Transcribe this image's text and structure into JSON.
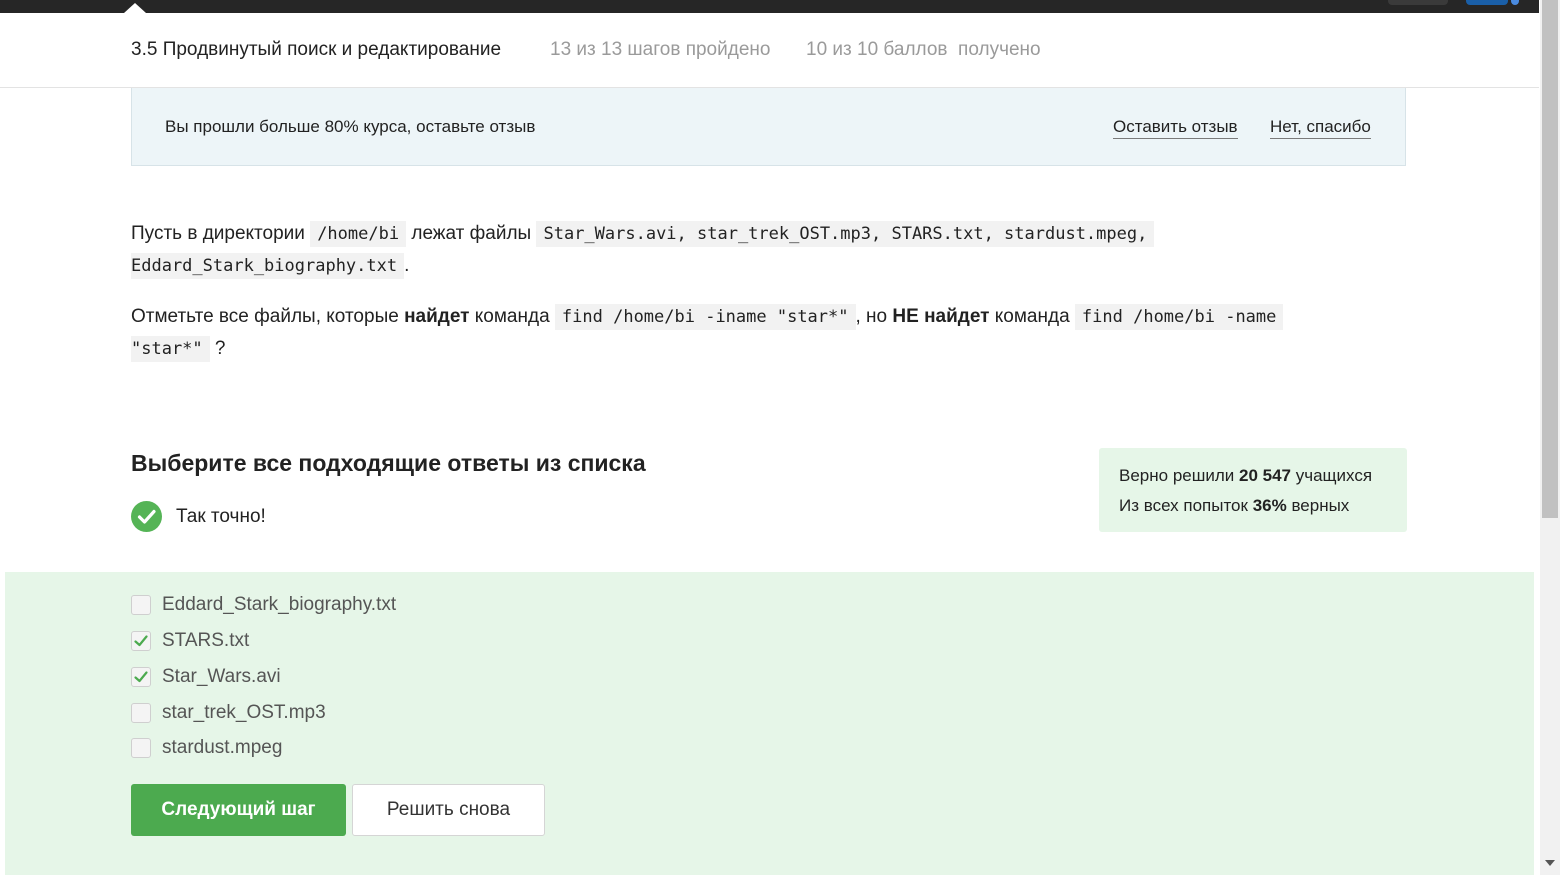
{
  "header": {
    "lesson_title": "3.5 Продвинутый поиск и редактирование",
    "steps_progress": "13 из 13 шагов пройдено",
    "points_progress": "10 из 10 баллов  получено"
  },
  "review_banner": {
    "text": "Вы прошли больше 80% курса, оставьте отзыв",
    "leave_review_label": "Оставить отзыв",
    "no_thanks_label": "Нет, спасибо"
  },
  "question": {
    "p1_before": "Пусть в директории ",
    "p1_dir": "/home/bi",
    "p1_middle": " лежат файлы ",
    "p1_files": "Star_Wars.avi, star_trek_OST.mp3, STARS.txt, stardust.mpeg,",
    "p1_file_last": "Eddard_Stark_biography.txt",
    "p1_end": ".",
    "p2_before": "Отметьте все файлы, которые ",
    "p2_bold1": "найдет",
    "p2_mid1": " команда ",
    "p2_cmd1": "find /home/bi -iname \"star*\"",
    "p2_mid2": ", но ",
    "p2_bold2": "НЕ найдет",
    "p2_mid3": " команда ",
    "p2_cmd2a": "find /home/bi -name",
    "p2_cmd2b": "\"star*\"",
    "p2_end": " ?"
  },
  "quiz": {
    "choose_title": "Выберите все подходящие ответы из списка",
    "correct_message": "Так точно!",
    "options": [
      {
        "label": "Eddard_Stark_biography.txt",
        "checked": false
      },
      {
        "label": "STARS.txt",
        "checked": true
      },
      {
        "label": "Star_Wars.avi",
        "checked": true
      },
      {
        "label": "star_trek_OST.mp3",
        "checked": false
      },
      {
        "label": "stardust.mpeg",
        "checked": false
      }
    ],
    "next_button_label": "Следующий шаг",
    "retry_button_label": "Решить снова"
  },
  "stats": {
    "solved_prefix": "Верно решили ",
    "solved_count": "20 547",
    "solved_suffix": " учащихся",
    "attempts_prefix": "Из всех попыток ",
    "attempts_percent": "36%",
    "attempts_suffix": " верных"
  },
  "colors": {
    "accent_green": "#4caa4f",
    "success_bg": "#e6f6e8",
    "banner_bg": "#edf5f8",
    "topbar": "#262626"
  }
}
